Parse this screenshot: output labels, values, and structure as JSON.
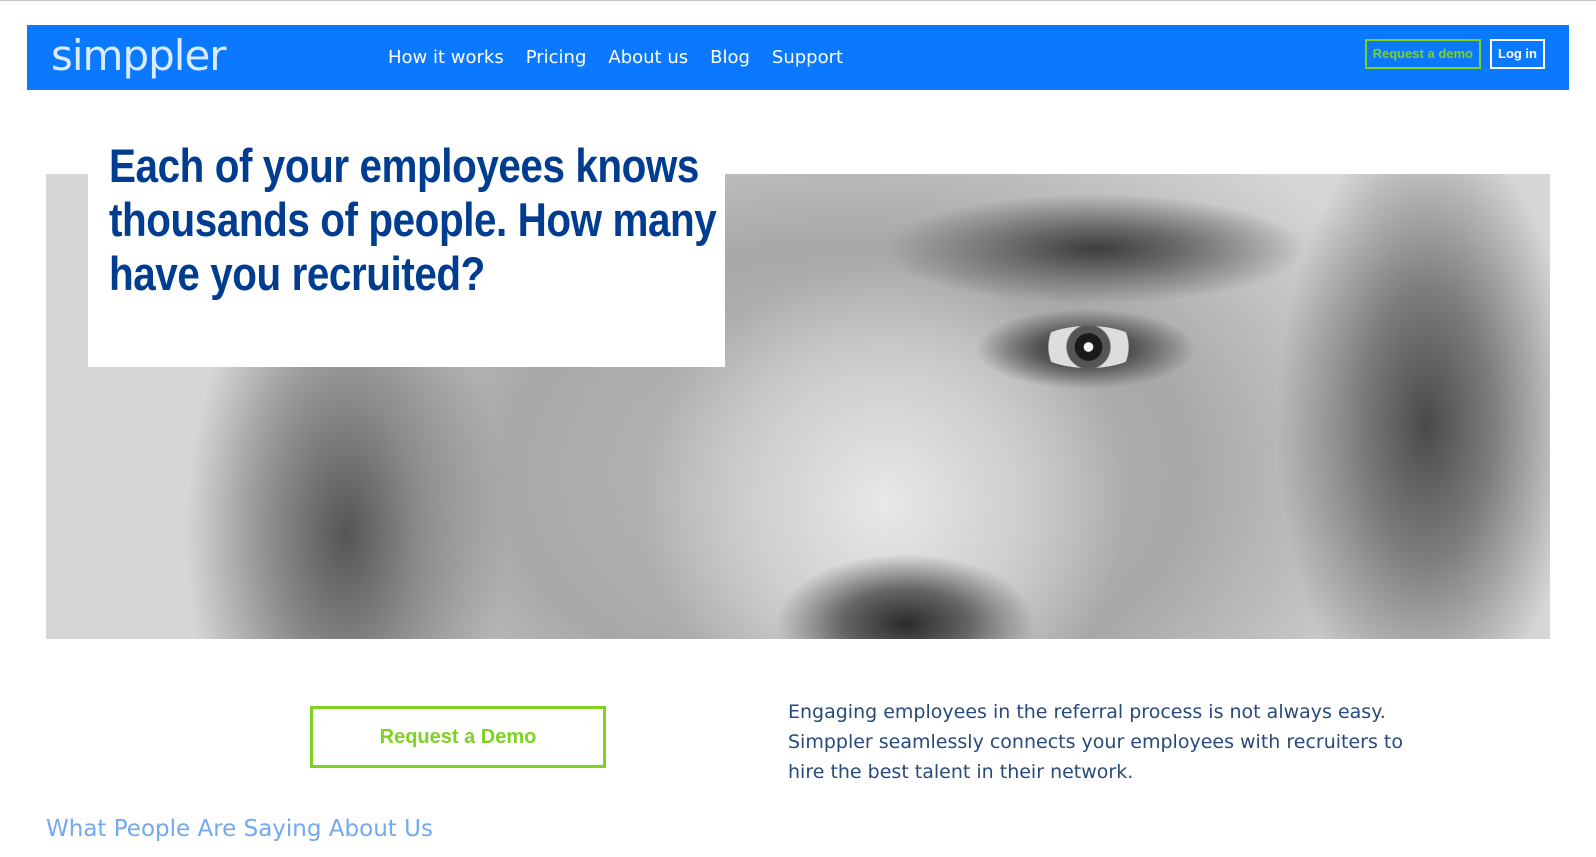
{
  "brand": {
    "logo_text": "simppler",
    "accent": "#0a78ff",
    "cta_color": "#7ed321"
  },
  "nav": {
    "links": [
      "How it works",
      "Pricing",
      "About us",
      "Blog",
      "Support"
    ],
    "request_demo_label": "Request a demo",
    "login_label": "Log in"
  },
  "hero": {
    "headline": "Each of your employees knows thousands of people. How many have you recruited?",
    "image": "portrait-photo"
  },
  "cta": {
    "label": "Request a Demo"
  },
  "intro": {
    "text": "Engaging employees in the referral process is not always easy. Simppler seamlessly connects your employees with recruiters to hire the best talent in their network."
  },
  "testimonials": {
    "title": "What People Are Saying About Us"
  }
}
